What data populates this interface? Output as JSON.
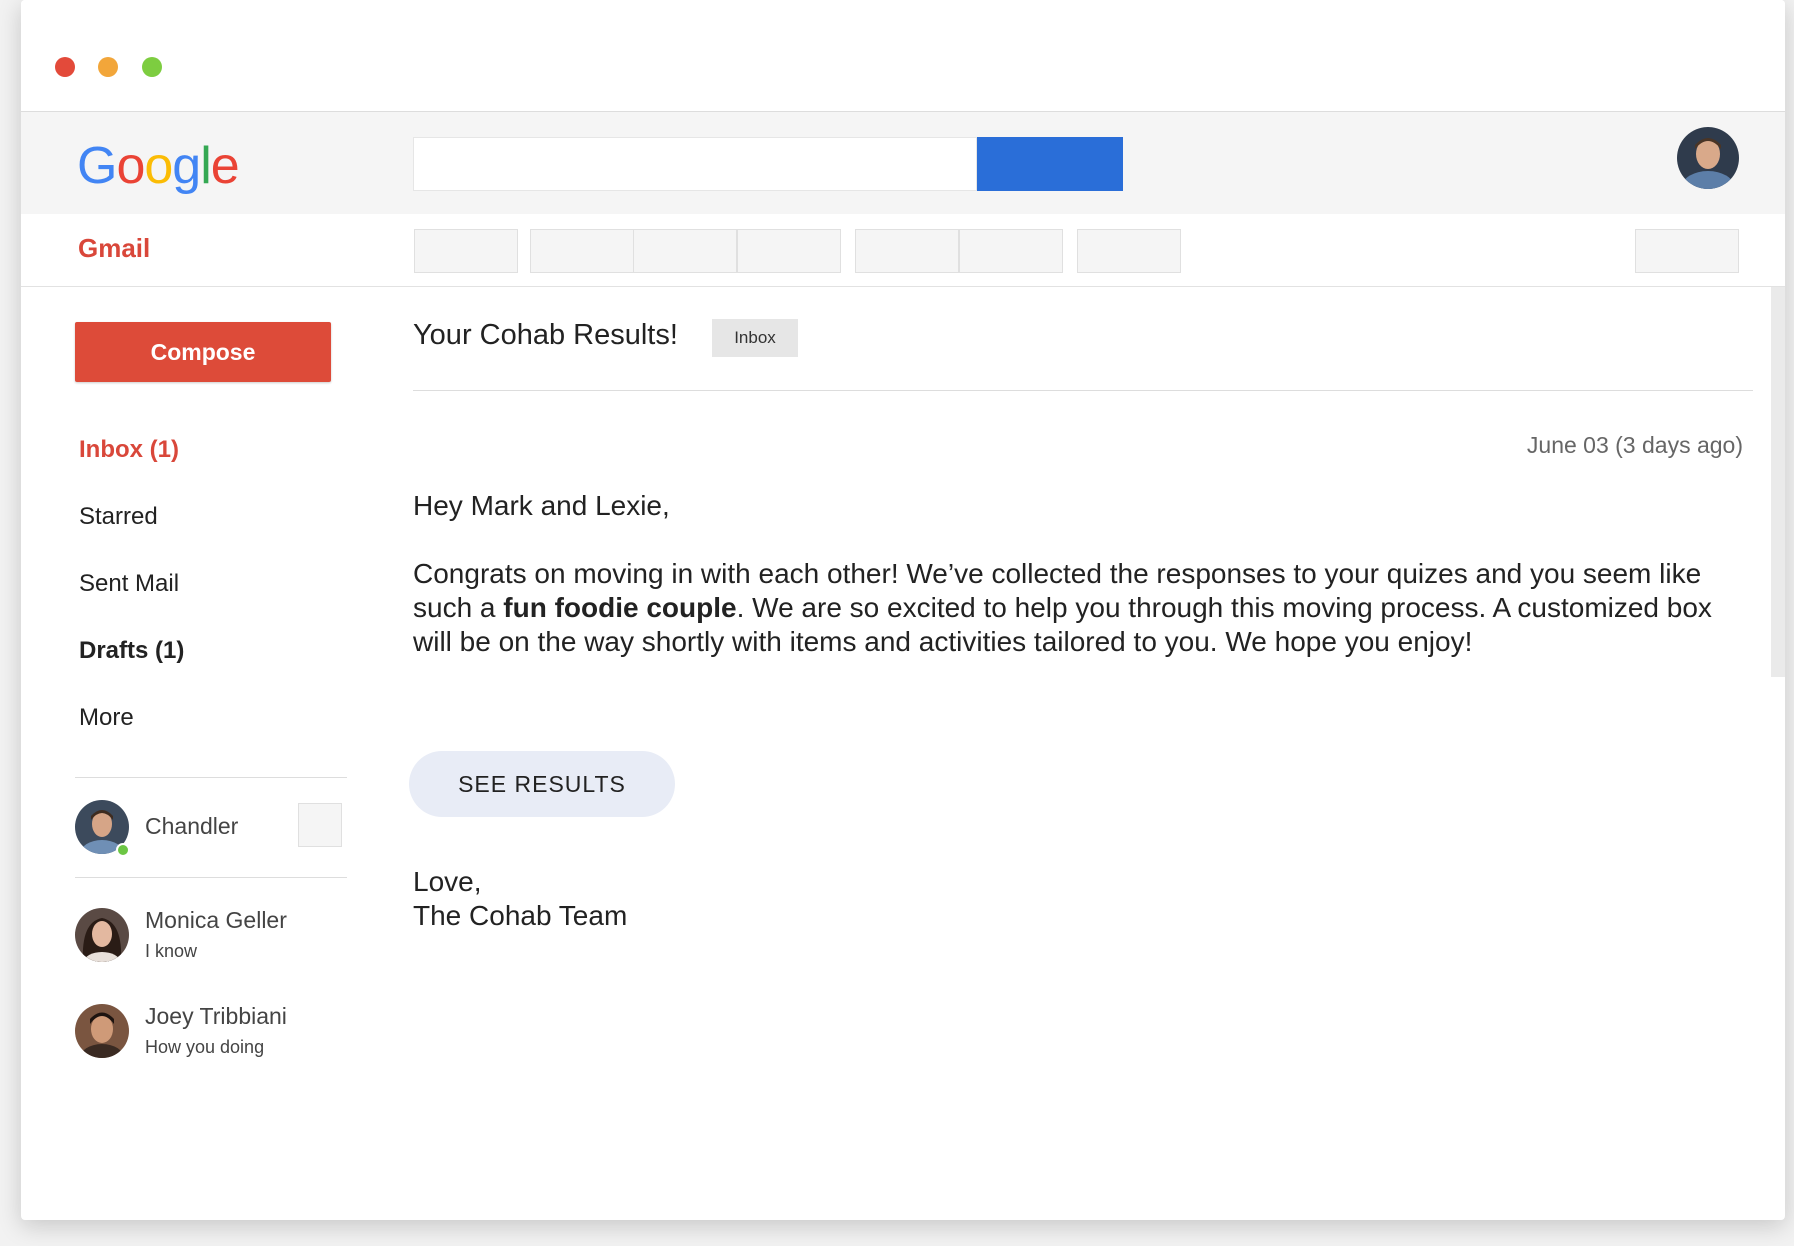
{
  "window": {
    "controls": [
      "close",
      "minimize",
      "maximize"
    ]
  },
  "header": {
    "logo": {
      "letters": [
        "G",
        "o",
        "o",
        "g",
        "l",
        "e"
      ],
      "colors": [
        "#4285F4",
        "#EA4335",
        "#FBBC05",
        "#4285F4",
        "#34A853",
        "#EA4335"
      ]
    },
    "search": {
      "placeholder": "",
      "button_color": "#2a6ed8"
    },
    "account_avatar": "user-avatar"
  },
  "subbar": {
    "app_label": "Gmail"
  },
  "sidebar": {
    "compose_label": "Compose",
    "nav": [
      {
        "label": "Inbox (1)",
        "active": true
      },
      {
        "label": "Starred"
      },
      {
        "label": "Sent Mail"
      },
      {
        "label": "Drafts (1)"
      },
      {
        "label": "More"
      }
    ],
    "chat": {
      "self": {
        "name": "Chandler",
        "status": "online"
      },
      "contacts": [
        {
          "name": "Monica Geller",
          "message": "I know"
        },
        {
          "name": "Joey Tribbiani",
          "message": "How you doing"
        }
      ]
    }
  },
  "email": {
    "subject": "Your Cohab Results!",
    "label": "Inbox",
    "date": "June 03 (3 days ago)",
    "greeting": "Hey Mark and Lexie,",
    "body_before": "Congrats on moving in with each other! We’ve collected the responses to your quizes and you seem like such a ",
    "body_bold": "fun foodie couple",
    "body_after": ". We are so excited to help you through this moving process. A customized box will be on the way shortly with items and activities tailored to you. We hope you enjoy!",
    "cta_label": "SEE RESULTS",
    "signoff_line1": "Love,",
    "signoff_line2": "The Cohab Team"
  },
  "colors": {
    "accent": "#dd4b39",
    "primary": "#2a6ed8",
    "presence": "#6cc644"
  }
}
